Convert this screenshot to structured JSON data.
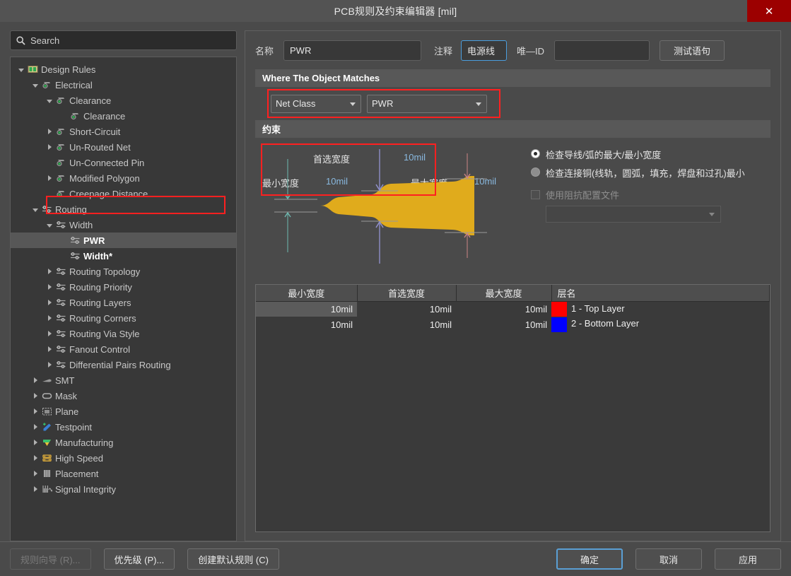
{
  "window": {
    "title": "PCB规则及约束编辑器 [mil]",
    "close_label": "✕",
    "close_icon": "close-icon",
    "accent_red": "#ff2020",
    "accent_blue": "#4a9ede",
    "close_bg": "#9c0000"
  },
  "search": {
    "placeholder": "Search",
    "value": "Search",
    "icon": "search-icon"
  },
  "tree": {
    "items": [
      {
        "label": "Design Rules",
        "depth": 0,
        "twisty": "open",
        "icon": "design-rules-icon",
        "state": "normal"
      },
      {
        "label": "Electrical",
        "depth": 1,
        "twisty": "open",
        "icon": "electrical-icon",
        "state": "normal"
      },
      {
        "label": "Clearance",
        "depth": 2,
        "twisty": "open",
        "icon": "electrical-icon",
        "state": "normal"
      },
      {
        "label": "Clearance",
        "depth": 3,
        "twisty": "none",
        "icon": "electrical-icon",
        "state": "normal"
      },
      {
        "label": "Short-Circuit",
        "depth": 2,
        "twisty": "closed",
        "icon": "electrical-icon",
        "state": "normal"
      },
      {
        "label": "Un-Routed Net",
        "depth": 2,
        "twisty": "closed",
        "icon": "electrical-icon",
        "state": "normal"
      },
      {
        "label": "Un-Connected Pin",
        "depth": 2,
        "twisty": "none",
        "icon": "electrical-icon",
        "state": "normal"
      },
      {
        "label": "Modified Polygon",
        "depth": 2,
        "twisty": "closed",
        "icon": "electrical-icon",
        "state": "normal"
      },
      {
        "label": "Creepage Distance",
        "depth": 2,
        "twisty": "none",
        "icon": "electrical-icon",
        "state": "normal"
      },
      {
        "label": "Routing",
        "depth": 1,
        "twisty": "open",
        "icon": "routing-icon",
        "state": "normal"
      },
      {
        "label": "Width",
        "depth": 2,
        "twisty": "open",
        "icon": "routing-icon",
        "state": "normal"
      },
      {
        "label": "PWR",
        "depth": 3,
        "twisty": "none",
        "icon": "routing-icon",
        "state": "selected"
      },
      {
        "label": "Width*",
        "depth": 3,
        "twisty": "none",
        "icon": "routing-icon",
        "state": "bold"
      },
      {
        "label": "Routing Topology",
        "depth": 2,
        "twisty": "closed",
        "icon": "routing-icon",
        "state": "normal"
      },
      {
        "label": "Routing Priority",
        "depth": 2,
        "twisty": "closed",
        "icon": "routing-icon",
        "state": "normal"
      },
      {
        "label": "Routing Layers",
        "depth": 2,
        "twisty": "closed",
        "icon": "routing-icon",
        "state": "normal"
      },
      {
        "label": "Routing Corners",
        "depth": 2,
        "twisty": "closed",
        "icon": "routing-icon",
        "state": "normal"
      },
      {
        "label": "Routing Via Style",
        "depth": 2,
        "twisty": "closed",
        "icon": "routing-icon",
        "state": "normal"
      },
      {
        "label": "Fanout Control",
        "depth": 2,
        "twisty": "closed",
        "icon": "routing-icon",
        "state": "normal"
      },
      {
        "label": "Differential Pairs Routing",
        "depth": 2,
        "twisty": "closed",
        "icon": "routing-icon",
        "state": "normal"
      },
      {
        "label": "SMT",
        "depth": 1,
        "twisty": "closed",
        "icon": "smt-icon",
        "state": "normal"
      },
      {
        "label": "Mask",
        "depth": 1,
        "twisty": "closed",
        "icon": "mask-icon",
        "state": "normal"
      },
      {
        "label": "Plane",
        "depth": 1,
        "twisty": "closed",
        "icon": "plane-icon",
        "state": "normal"
      },
      {
        "label": "Testpoint",
        "depth": 1,
        "twisty": "closed",
        "icon": "testpoint-icon",
        "state": "normal"
      },
      {
        "label": "Manufacturing",
        "depth": 1,
        "twisty": "closed",
        "icon": "manufacturing-icon",
        "state": "normal"
      },
      {
        "label": "High Speed",
        "depth": 1,
        "twisty": "closed",
        "icon": "high-speed-icon",
        "state": "normal"
      },
      {
        "label": "Placement",
        "depth": 1,
        "twisty": "closed",
        "icon": "placement-icon",
        "state": "normal"
      },
      {
        "label": "Signal Integrity",
        "depth": 1,
        "twisty": "closed",
        "icon": "signal-integrity-icon",
        "state": "normal"
      }
    ]
  },
  "form": {
    "name_label": "名称",
    "name_value": "PWR",
    "comment_label": "注释",
    "comment_value": "电源线",
    "unique_id_label": "唯—ID",
    "unique_id_value": "",
    "test_query_label": "测试语句"
  },
  "match_section": {
    "header": "Where The Object Matches",
    "scope_value": "Net Class",
    "target_value": "PWR"
  },
  "constraints": {
    "header": "约束",
    "preferred_label": "首选宽度",
    "preferred_value": "10mil",
    "min_label": "最小宽度",
    "min_value": "10mil",
    "max_label": "最大宽度",
    "max_value": "10mil",
    "radio_track_label": "检查导线/弧的最大/最小宽度",
    "radio_track_selected": true,
    "radio_copper_label": "检查连接铜(线轨，圆弧，填充，焊盘和过孔)最小",
    "radio_copper_selected": false,
    "impedance_checkbox_label": "使用阻抗配置文件",
    "impedance_checked": false,
    "impedance_value": ""
  },
  "table": {
    "columns": [
      "最小宽度",
      "首选宽度",
      "最大宽度",
      "层名"
    ],
    "rows": [
      {
        "min": "10mil",
        "preferred": "10mil",
        "max": "10mil",
        "layer": "1 - Top Layer",
        "color": "#ff0000",
        "selected": true
      },
      {
        "min": "10mil",
        "preferred": "10mil",
        "max": "10mil",
        "layer": "2 - Bottom Layer",
        "color": "#0000ff",
        "selected": false
      }
    ]
  },
  "footer": {
    "rule_wizard": "规则向导 (R)...",
    "priority": "优先级 (P)...",
    "create_default": "创建默认规则 (C)",
    "ok": "确定",
    "cancel": "取消",
    "apply": "应用"
  }
}
